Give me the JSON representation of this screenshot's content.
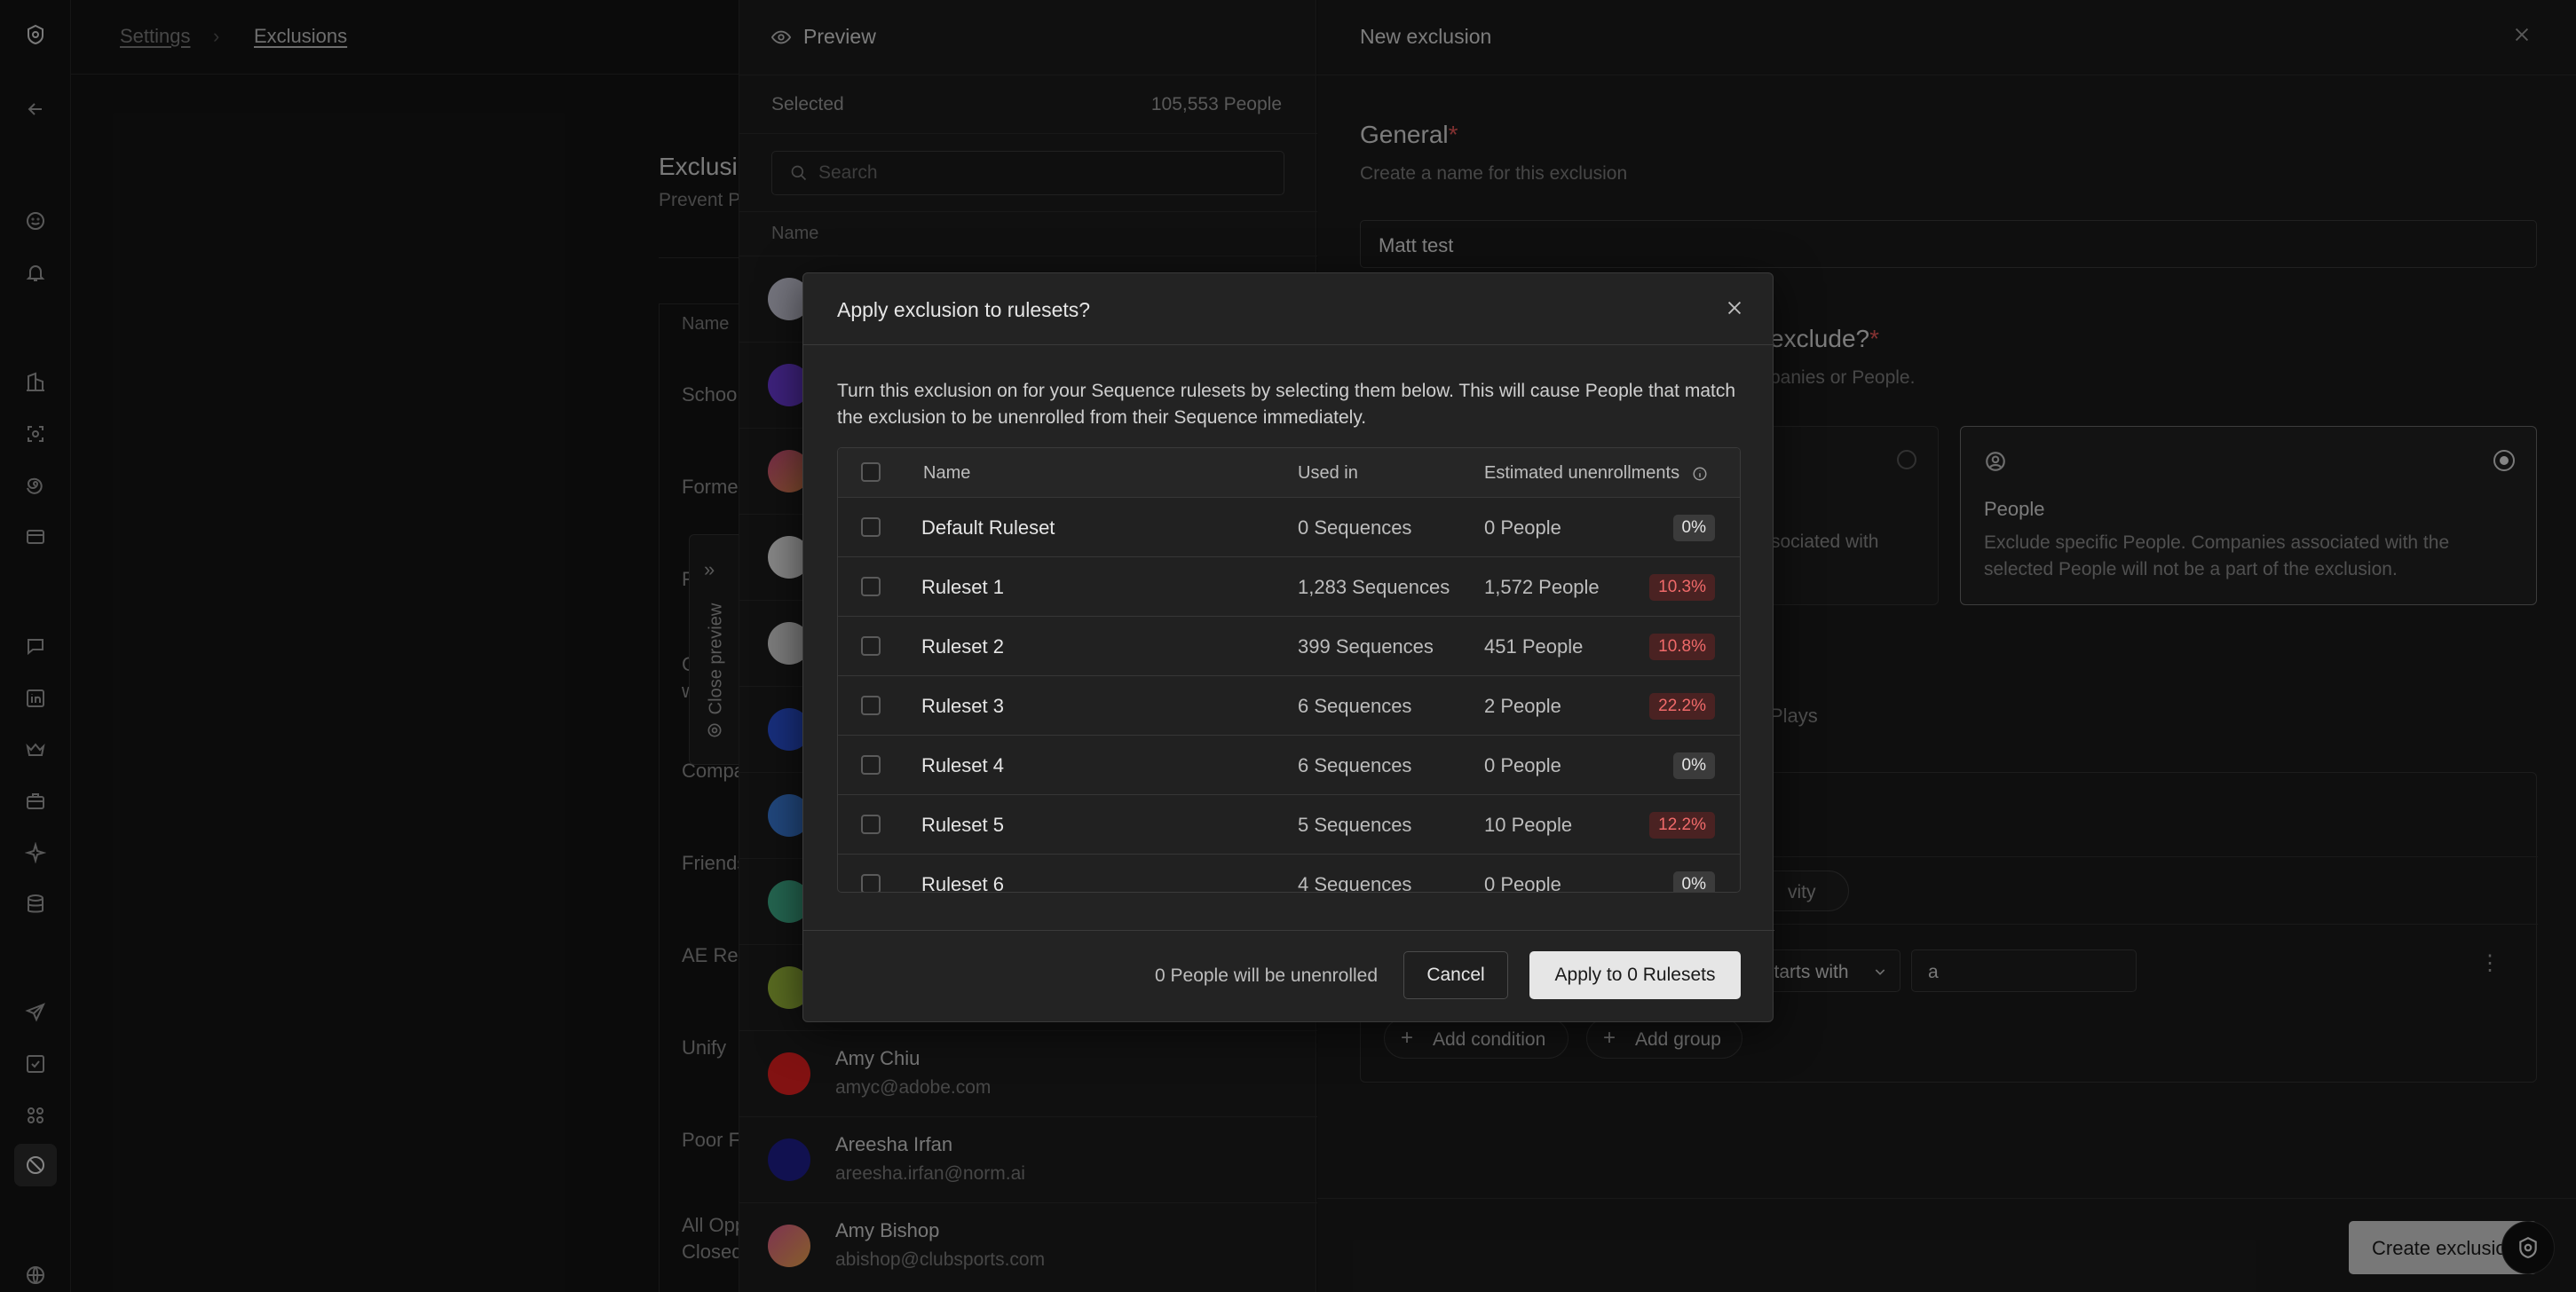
{
  "breadcrumb": {
    "parent": "Settings",
    "current": "Exclusions"
  },
  "background_list": {
    "title": "Exclusi",
    "subtitle": "Prevent P",
    "column_name": "Name",
    "rows": [
      "Schoo",
      "Forme",
      "F",
      "C\nw",
      "Compa",
      "Friends",
      "AE Re",
      "Unify",
      "Poor F",
      "All Opp\nClosed"
    ]
  },
  "close_preview": "Close preview",
  "preview": {
    "title": "Preview",
    "selected_label": "Selected",
    "selected_count": "105,553 People",
    "search_placeholder": "Search",
    "column_name": "Name",
    "people": [
      {
        "name": "Amy Chiu",
        "email": "amyc@adobe.com"
      },
      {
        "name": "Areesha Irfan",
        "email": "areesha.irfan@norm.ai"
      },
      {
        "name": "Amy Bishop",
        "email": "abishop@clubsports.com"
      }
    ]
  },
  "form": {
    "title": "New exclusion",
    "general_title": "General",
    "required_mark": "*",
    "general_desc": "Create a name for this exclusion",
    "name_value": "Matt test",
    "exclude_title": "exclude?",
    "exclude_desc": "panies or People.",
    "company_card_frag": "sociated with",
    "people_card": {
      "title": "People",
      "desc": "Exclude specific People. Companies associated with the selected People will not be a part of the exclusion."
    },
    "plays_frag": "Plays",
    "activity_frag": "vity",
    "operator": "starts with",
    "condition_value": "a",
    "add_condition": "Add condition",
    "add_group": "Add group",
    "create_button": "Create exclusio"
  },
  "modal": {
    "title": "Apply exclusion to rulesets?",
    "description": "Turn this exclusion on for your Sequence rulesets by selecting them below. This will cause People that match the exclusion to be unenrolled from their Sequence immediately.",
    "columns": {
      "name": "Name",
      "used_in": "Used in",
      "estimated": "Estimated unenrollments"
    },
    "rows": [
      {
        "name": "Default Ruleset",
        "used_in": "0 Sequences",
        "people": "0 People",
        "pct": "0%"
      },
      {
        "name": "Ruleset 1",
        "used_in": "1,283 Sequences",
        "people": "1,572 People",
        "pct": "10.3%"
      },
      {
        "name": "Ruleset 2",
        "used_in": "399 Sequences",
        "people": "451 People",
        "pct": "10.8%"
      },
      {
        "name": "Ruleset 3",
        "used_in": "6 Sequences",
        "people": "2 People",
        "pct": "22.2%"
      },
      {
        "name": "Ruleset 4",
        "used_in": "6 Sequences",
        "people": "0 People",
        "pct": "0%"
      },
      {
        "name": "Ruleset 5",
        "used_in": "5 Sequences",
        "people": "10 People",
        "pct": "12.2%"
      },
      {
        "name": "Ruleset 6",
        "used_in": "4 Sequences",
        "people": "0 People",
        "pct": "0%"
      }
    ],
    "footer_summary": "0 People will be unenrolled",
    "cancel_label": "Cancel",
    "apply_label": "Apply to 0 Rulesets"
  },
  "colors": {
    "background": "#141414",
    "panel": "#1c1c1c",
    "modal": "#232323",
    "danger_text": "#f06a6a",
    "danger_bg": "#4a2222",
    "required": "#e05555"
  }
}
